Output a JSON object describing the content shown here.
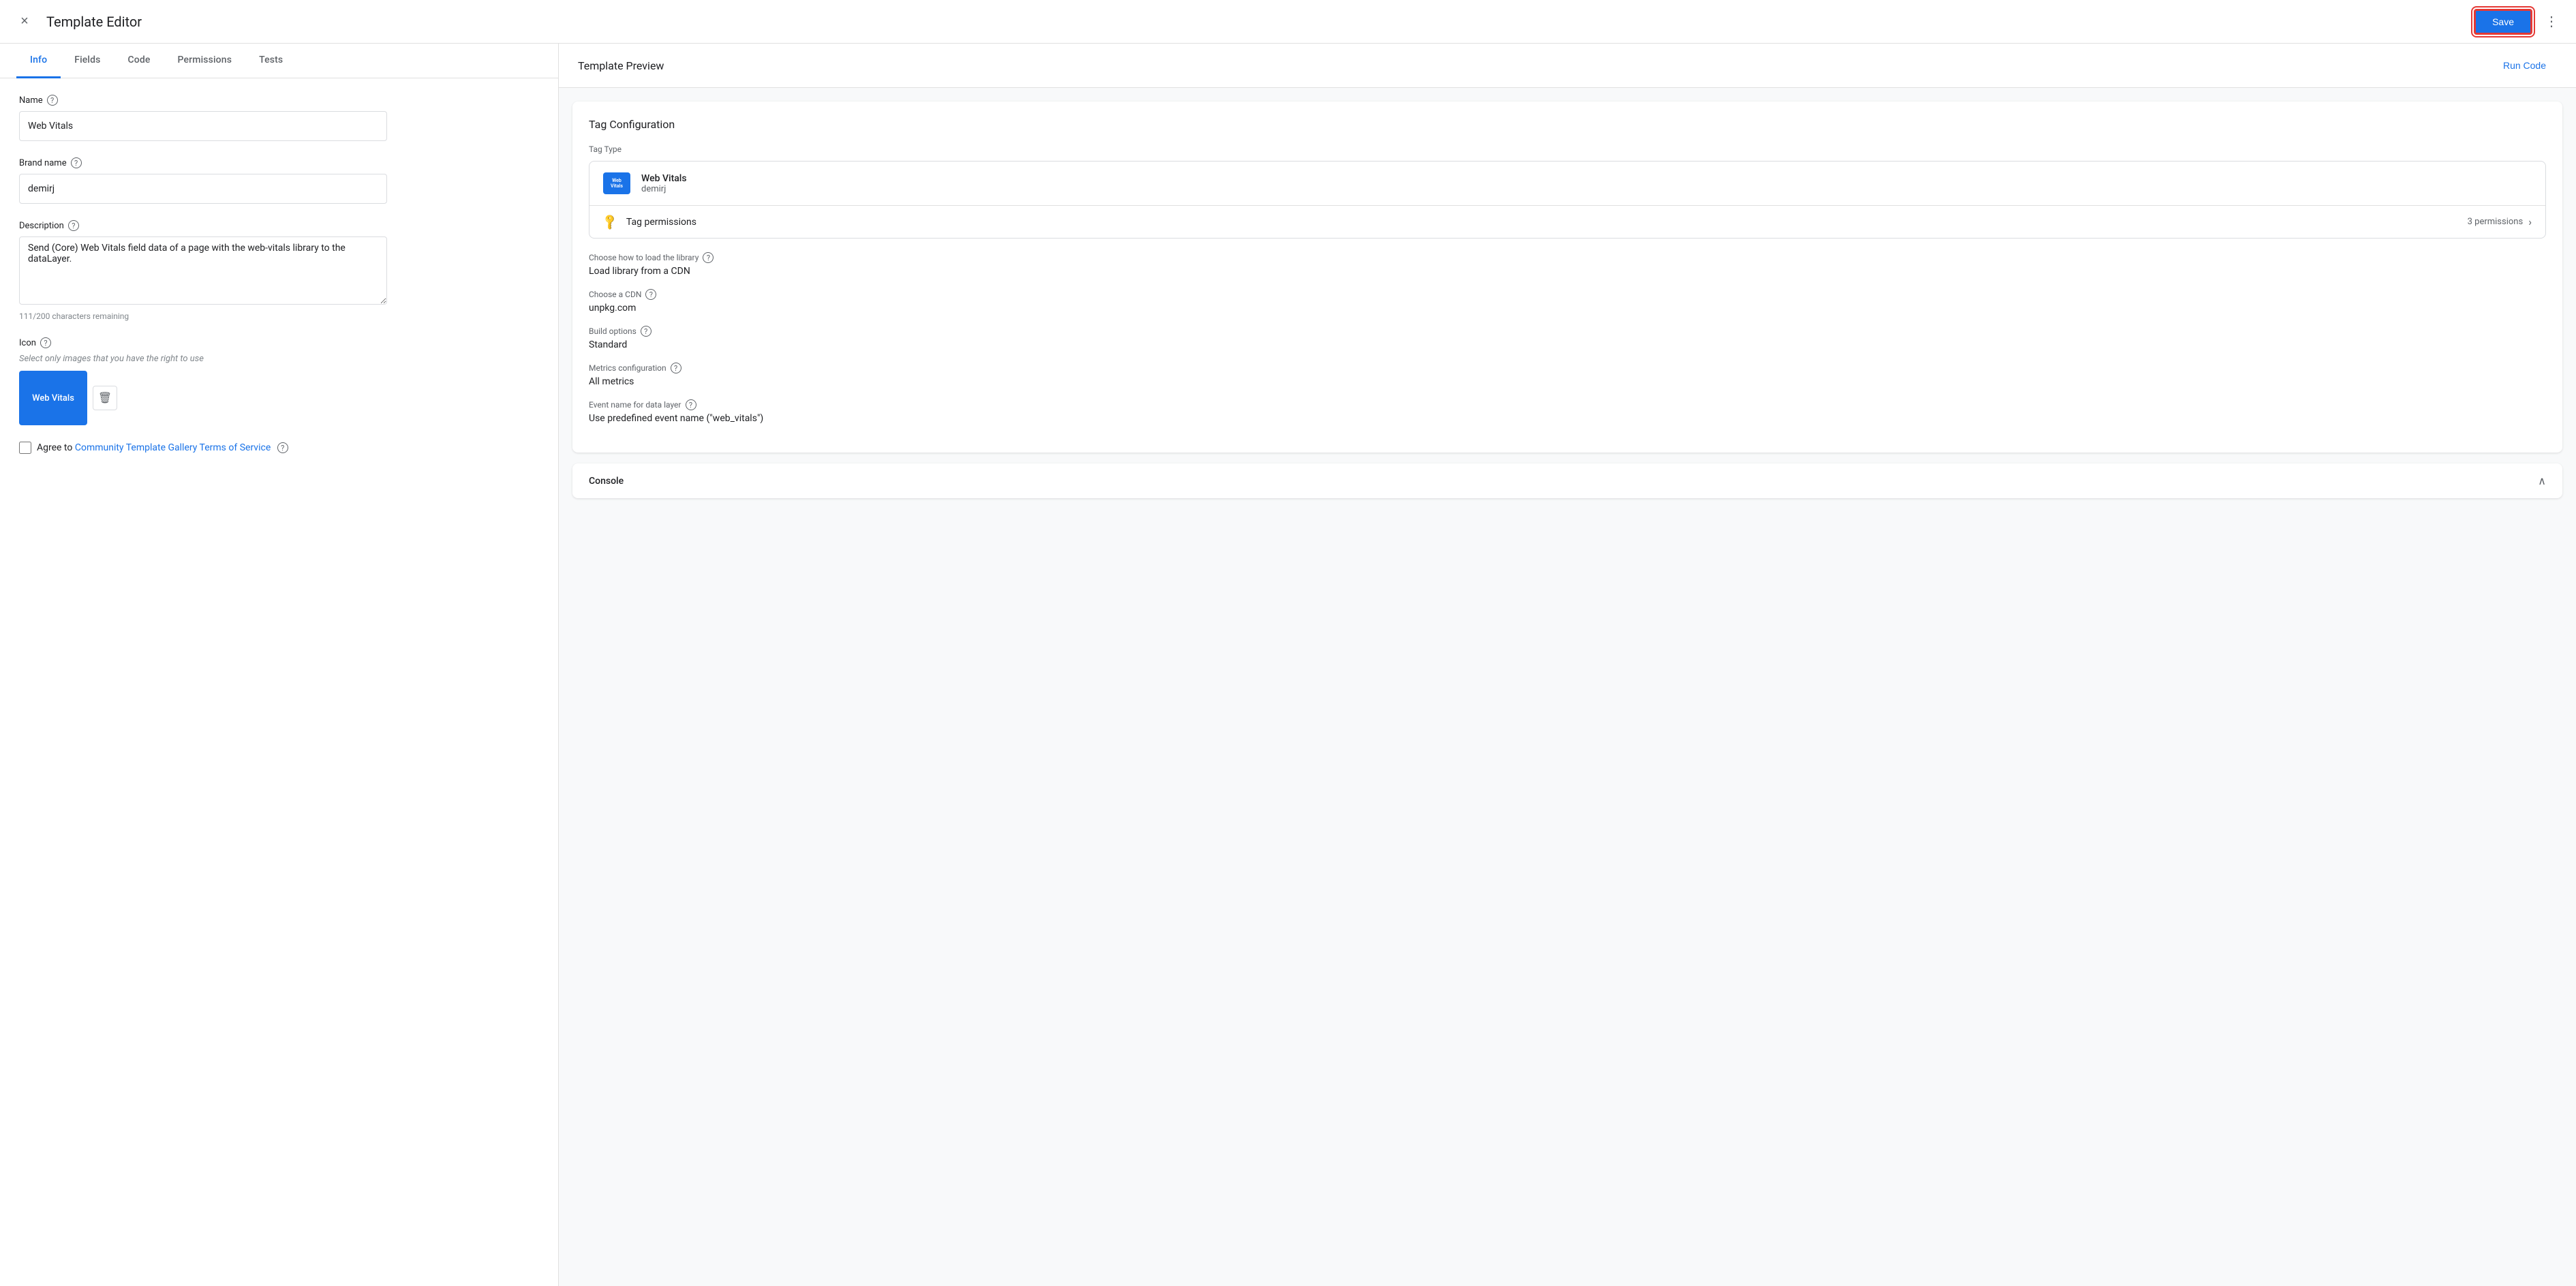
{
  "topBar": {
    "title": "Template Editor",
    "saveLabel": "Save",
    "closeIcon": "×",
    "moreIcon": "⋮"
  },
  "tabs": [
    {
      "id": "info",
      "label": "Info",
      "active": true
    },
    {
      "id": "fields",
      "label": "Fields",
      "active": false
    },
    {
      "id": "code",
      "label": "Code",
      "active": false
    },
    {
      "id": "permissions",
      "label": "Permissions",
      "active": false
    },
    {
      "id": "tests",
      "label": "Tests",
      "active": false
    }
  ],
  "form": {
    "nameLabel": "Name",
    "nameValue": "Web Vitals",
    "brandLabel": "Brand name",
    "brandValue": "demirj",
    "descriptionLabel": "Description",
    "descriptionValue": "Send (Core) Web Vitals field data of a page with the web-vitals library to the dataLayer.",
    "charCount": "111/200 characters remaining",
    "iconLabel": "Icon",
    "iconHint": "Select only images that you have the right to use",
    "iconText": "Web Vitals",
    "agreeText": "Agree to ",
    "agreeLinkText": "Community Template Gallery Terms of Service"
  },
  "preview": {
    "title": "Template Preview",
    "runCodeLabel": "Run Code",
    "tagConfig": {
      "title": "Tag Configuration",
      "tagTypeLabel": "Tag Type",
      "tagName": "Web Vitals",
      "tagBrand": "demirj",
      "tagPermissionsLabel": "Tag permissions",
      "permissionsCount": "3 permissions",
      "loadLibraryLabel": "Choose how to load the library",
      "loadLibraryValue": "Load library from a CDN",
      "cdnLabel": "Choose a CDN",
      "cdnValue": "unpkg.com",
      "buildOptionsLabel": "Build options",
      "buildOptionsValue": "Standard",
      "metricsLabel": "Metrics configuration",
      "metricsValue": "All metrics",
      "eventNameLabel": "Event name for data layer",
      "eventNameValue": "Use predefined event name (\"web_vitals\")"
    },
    "console": {
      "title": "Console",
      "toggleIcon": "∧"
    }
  }
}
